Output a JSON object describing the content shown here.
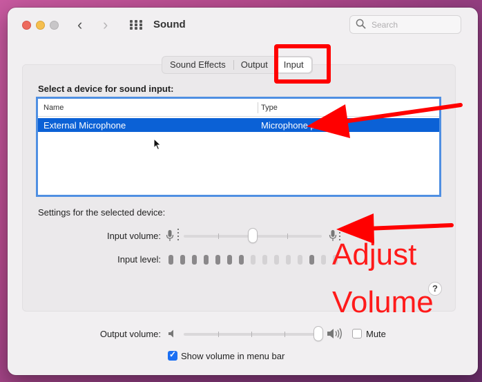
{
  "window": {
    "title": "Sound",
    "search_placeholder": "Search"
  },
  "tabs": [
    {
      "label": "Sound Effects",
      "active": false
    },
    {
      "label": "Output",
      "active": false
    },
    {
      "label": "Input",
      "active": true
    }
  ],
  "input": {
    "section_title": "Select a device for sound input:",
    "columns": {
      "name": "Name",
      "type": "Type"
    },
    "devices": [
      {
        "name": "External Microphone",
        "type": "Microphone port",
        "selected": true
      }
    ],
    "settings_title": "Settings for the selected device:",
    "input_volume_label": "Input volume:",
    "input_volume_fraction": 0.5,
    "input_level_label": "Input level:",
    "input_level_active_bars": 7,
    "input_level_total_bars": 15
  },
  "output": {
    "volume_label": "Output volume:",
    "volume_fraction": 1.0,
    "mute_label": "Mute",
    "mute_checked": false,
    "show_in_menu_label": "Show volume in menu bar",
    "show_in_menu_checked": true
  },
  "help_label": "?",
  "annotation": {
    "line1": "Adjust",
    "line2": "Volume",
    "color": "#ff1a1a"
  },
  "colors": {
    "selection": "#0b61d6",
    "accent": "#1b6ff3"
  }
}
